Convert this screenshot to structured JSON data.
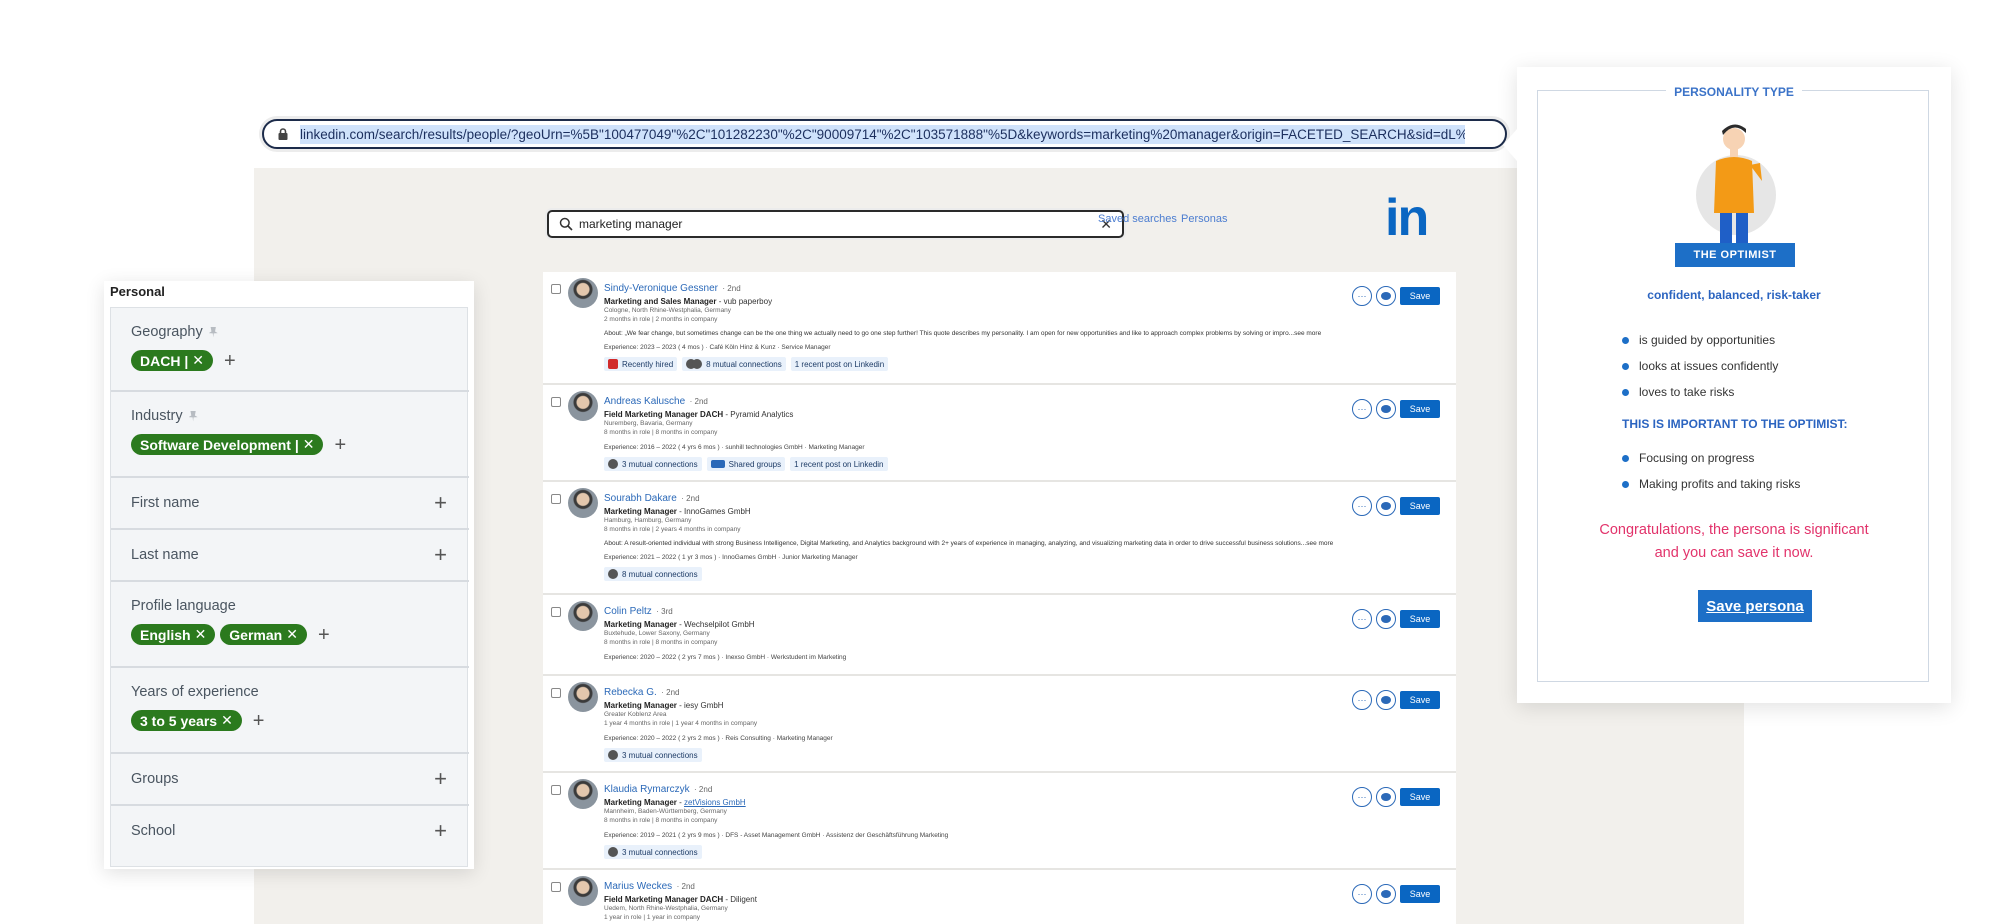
{
  "browser": {
    "url": "linkedin.com/search/results/people/?geoUrn=%5B\"100477049\"%2C\"101282230\"%2C\"90009714\"%2C\"103571888\"%5D&keywords=marketing%20manager&origin=FACETED_SEARCH&sid=dL%2C"
  },
  "search": {
    "query": "marketing manager",
    "saved_searches": "Saved searches",
    "personas": "Personas",
    "logo": "in"
  },
  "results": [
    {
      "name": "Sindy-Veronique Gessner",
      "degree": "· 2nd",
      "role": "Marketing and Sales Manager",
      "company": " - vub paperboy",
      "location": "Cologne, North Rhine-Westphalia, Germany",
      "tenure": "2 months in role | 2 months in company",
      "about": "About: „We fear change, but sometimes change can be the one thing we actually need to go one step further! This quote describes my personality. I am open for new opportunities and like to approach complex problems by solving or impro...see more",
      "experience": "Experience: 2023 – 2023 ( 4 mos ) · Café Köln Hinz & Kunz · Service Manager",
      "chips": [
        "Recently hired",
        "8 mutual connections",
        "1 recent post on Linkedin"
      ]
    },
    {
      "name": "Andreas Kalusche",
      "degree": "· 2nd",
      "role": "Field Marketing Manager DACH",
      "company": " - Pyramid Analytics",
      "location": "Nuremberg, Bavaria, Germany",
      "tenure": "8 months in role | 8 months in company",
      "experience": "Experience: 2016 – 2022 ( 4 yrs 6 mos ) · sunhill technologies GmbH · Marketing Manager",
      "chips": [
        "3 mutual connections",
        "Shared groups",
        "1 recent post on Linkedin"
      ]
    },
    {
      "name": "Sourabh Dakare",
      "degree": "· 2nd",
      "role": "Marketing Manager",
      "company": " - InnoGames GmbH",
      "location": "Hamburg, Hamburg, Germany",
      "tenure": "8 months in role | 2 years 4 months in company",
      "about": "About: A result-oriented individual with strong Business Intelligence, Digital Marketing, and Analytics background with 2+ years of experience in managing, analyzing, and visualizing marketing data in order to drive successful business solutions...see more",
      "experience": "Experience: 2021 – 2022 ( 1 yr 3 mos ) · InnoGames GmbH · Junior Marketing Manager",
      "chips": [
        "8 mutual connections"
      ]
    },
    {
      "name": "Colin Peltz",
      "degree": "· 3rd",
      "role": "Marketing Manager",
      "company": " - Wechselpilot GmbH",
      "location": "Buxtehude, Lower Saxony, Germany",
      "tenure": "8 months in role | 8 months in company",
      "experience": "Experience: 2020 – 2022 ( 2 yrs 7 mos ) · Inexso GmbH · Werkstudent im Marketing",
      "chips": []
    },
    {
      "name": "Rebecka G.",
      "degree": "· 2nd",
      "role": "Marketing Manager",
      "company": " - iesy GmbH",
      "location": "Greater Koblenz Area",
      "tenure": "1 year 4 months in role | 1 year 4 months in company",
      "experience": "Experience: 2020 – 2022 ( 2 yrs 2 mos ) · Reis Consulting · Marketing Manager",
      "chips": [
        "3 mutual connections"
      ]
    },
    {
      "name": "Klaudia Rymarczyk",
      "degree": "· 2nd",
      "role": "Marketing Manager",
      "company": "zetVisions GmbH",
      "location": "Mannheim, Baden-Württemberg, Germany",
      "tenure": "8 months in role | 8 months in company",
      "experience": "Experience: 2019 – 2021 ( 2 yrs 9 mos ) · DFS - Asset Management GmbH · Assistenz der Geschäftsführung Marketing",
      "chips": [
        "3 mutual connections"
      ]
    },
    {
      "name": "Marius Weckes",
      "degree": "· 2nd",
      "role": "Field Marketing Manager DACH",
      "company": " - Diligent",
      "location": "Uedem, North Rhine-Westphalia, Germany",
      "tenure": "1 year in role | 1 year in company",
      "chips": []
    }
  ],
  "actions": {
    "more": "···",
    "save": "Save"
  },
  "filters": {
    "title": "Personal",
    "geography": {
      "label": "Geography",
      "tags": [
        "DACH |"
      ]
    },
    "industry": {
      "label": "Industry",
      "tags": [
        "Software Development |"
      ]
    },
    "first_name": "First name",
    "last_name": "Last name",
    "profile_language": {
      "label": "Profile language",
      "tags": [
        "English",
        "German"
      ]
    },
    "years": {
      "label": "Years of experience",
      "tags": [
        "3 to 5 years"
      ]
    },
    "groups": "Groups",
    "school": "School"
  },
  "persona": {
    "heading": "PERSONALITY TYPE",
    "badge": "THE OPTIMIST",
    "traits": "confident, balanced, risk-taker",
    "bullets": [
      "is guided by opportunities",
      "looks at issues confidently",
      "loves to take risks"
    ],
    "important_heading": "THIS IS IMPORTANT TO THE OPTIMIST:",
    "important": [
      "Focusing on progress",
      "Making profits and taking risks"
    ],
    "congrats_line1": "Congratulations, the persona is significant",
    "congrats_line2": "and you can save it now.",
    "save_button": "Save persona"
  },
  "colors": {
    "linkedin_blue": "#0a66c2",
    "tag_green": "#2b7a1e",
    "congrats_pink": "#e2336b"
  }
}
